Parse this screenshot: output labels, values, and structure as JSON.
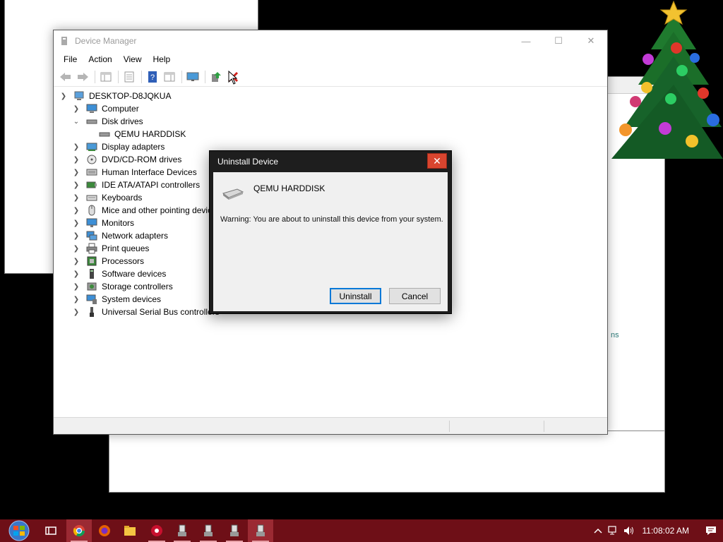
{
  "device_manager": {
    "title": "Device Manager",
    "window_controls": {
      "minimize": "—",
      "maximize": "☐",
      "close": "✕"
    },
    "menu": [
      "File",
      "Action",
      "View",
      "Help"
    ],
    "tree": {
      "root": "DESKTOP-D8JQKUA",
      "items": [
        {
          "label": "Computer",
          "expanded": false,
          "icon": "computer-icon"
        },
        {
          "label": "Disk drives",
          "expanded": true,
          "icon": "disk-drive-icon",
          "children": [
            {
              "label": "QEMU HARDDISK",
              "icon": "disk-drive-icon"
            }
          ]
        },
        {
          "label": "Display adapters",
          "expanded": false,
          "icon": "display-adapter-icon"
        },
        {
          "label": "DVD/CD-ROM drives",
          "expanded": false,
          "icon": "dvd-icon"
        },
        {
          "label": "Human Interface Devices",
          "expanded": false,
          "icon": "hid-icon"
        },
        {
          "label": "IDE ATA/ATAPI controllers",
          "expanded": false,
          "icon": "ide-controller-icon"
        },
        {
          "label": "Keyboards",
          "expanded": false,
          "icon": "keyboard-icon"
        },
        {
          "label": "Mice and other pointing devices",
          "expanded": false,
          "icon": "mouse-icon"
        },
        {
          "label": "Monitors",
          "expanded": false,
          "icon": "monitor-icon"
        },
        {
          "label": "Network adapters",
          "expanded": false,
          "icon": "network-adapter-icon"
        },
        {
          "label": "Print queues",
          "expanded": false,
          "icon": "printer-icon"
        },
        {
          "label": "Processors",
          "expanded": false,
          "icon": "processor-icon"
        },
        {
          "label": "Software devices",
          "expanded": false,
          "icon": "software-device-icon"
        },
        {
          "label": "Storage controllers",
          "expanded": false,
          "icon": "storage-controller-icon"
        },
        {
          "label": "System devices",
          "expanded": false,
          "icon": "system-device-icon"
        },
        {
          "label": "Universal Serial Bus controllers",
          "expanded": false,
          "icon": "usb-icon"
        }
      ]
    }
  },
  "dialog": {
    "title": "Uninstall Device",
    "close": "✕",
    "device_name": "QEMU HARDDISK",
    "warning": "Warning: You are about to uninstall this device from your system.",
    "uninstall_label": "Uninstall",
    "cancel_label": "Cancel"
  },
  "background": {
    "partial_text": "ns"
  },
  "taskbar": {
    "clock": "11:08:02 AM",
    "colors": {
      "bar": "#6e0f17",
      "active": "#9b2a33"
    }
  }
}
